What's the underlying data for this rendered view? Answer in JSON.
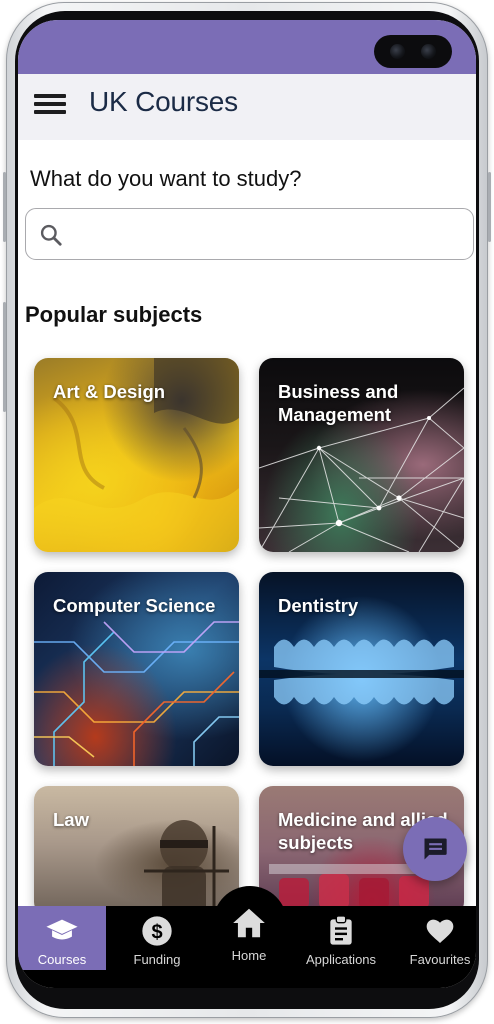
{
  "app_bar": {
    "title": "UK Courses",
    "menu_icon": "hamburger-menu-icon"
  },
  "search": {
    "prompt": "What do you want to study?",
    "placeholder": "",
    "value": "",
    "icon": "search-icon"
  },
  "popular": {
    "title": "Popular subjects",
    "subjects": [
      {
        "label": "Art & Design"
      },
      {
        "label": "Business and Management"
      },
      {
        "label": "Computer Science"
      },
      {
        "label": "Dentistry"
      },
      {
        "label": "Law"
      },
      {
        "label": "Medicine and allied subjects"
      }
    ]
  },
  "fab": {
    "icon": "chat-message-icon"
  },
  "bottom_nav": {
    "items": [
      {
        "label": "Courses",
        "icon": "graduation-cap-icon",
        "active": true
      },
      {
        "label": "Funding",
        "icon": "dollar-circle-icon",
        "active": false
      },
      {
        "label": "Home",
        "icon": "home-icon",
        "active": false
      },
      {
        "label": "Applications",
        "icon": "clipboard-icon",
        "active": false
      },
      {
        "label": "Favourites",
        "icon": "heart-icon",
        "active": false
      }
    ]
  },
  "colors": {
    "accent": "#7b6db6",
    "title_text": "#1b2b46",
    "nav_background": "#000000"
  }
}
